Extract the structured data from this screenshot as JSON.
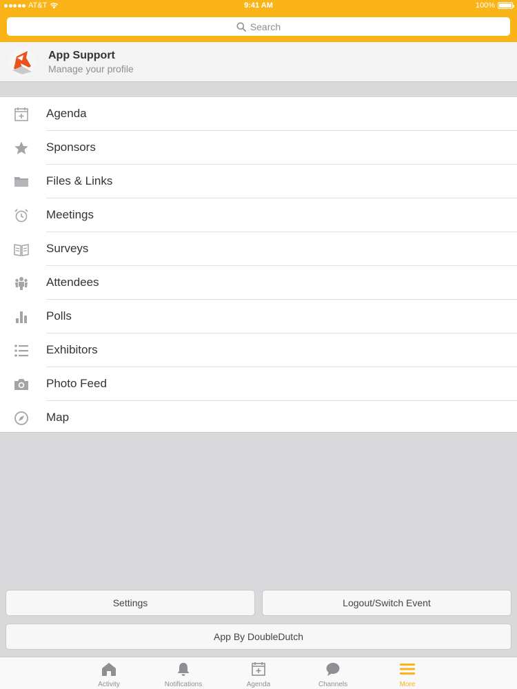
{
  "status_bar": {
    "carrier": "AT&T",
    "time": "9:41 AM",
    "battery": "100%"
  },
  "search": {
    "placeholder": "Search"
  },
  "profile": {
    "name": "App Support",
    "subtitle": "Manage your profile"
  },
  "menu": [
    {
      "label": "Agenda",
      "icon": "calendar-add-icon"
    },
    {
      "label": "Sponsors",
      "icon": "star-icon"
    },
    {
      "label": "Files & Links",
      "icon": "folder-icon"
    },
    {
      "label": "Meetings",
      "icon": "alarm-clock-icon"
    },
    {
      "label": "Surveys",
      "icon": "open-book-icon"
    },
    {
      "label": "Attendees",
      "icon": "people-icon"
    },
    {
      "label": "Polls",
      "icon": "bar-chart-icon"
    },
    {
      "label": "Exhibitors",
      "icon": "list-icon"
    },
    {
      "label": "Photo Feed",
      "icon": "camera-icon"
    },
    {
      "label": "Map",
      "icon": "compass-icon"
    }
  ],
  "buttons": {
    "settings": "Settings",
    "logout": "Logout/Switch Event",
    "app_by": "App By DoubleDutch"
  },
  "tabs": [
    {
      "label": "Activity",
      "icon": "home-icon",
      "active": false
    },
    {
      "label": "Notifications",
      "icon": "bell-icon",
      "active": false
    },
    {
      "label": "Agenda",
      "icon": "calendar-add-icon",
      "active": false
    },
    {
      "label": "Channels",
      "icon": "chat-bubble-icon",
      "active": false
    },
    {
      "label": "More",
      "icon": "menu-icon",
      "active": true
    }
  ],
  "colors": {
    "accent": "#fbb418",
    "icon_gray": "#a3a3a8",
    "background": "#d9d9dc"
  }
}
